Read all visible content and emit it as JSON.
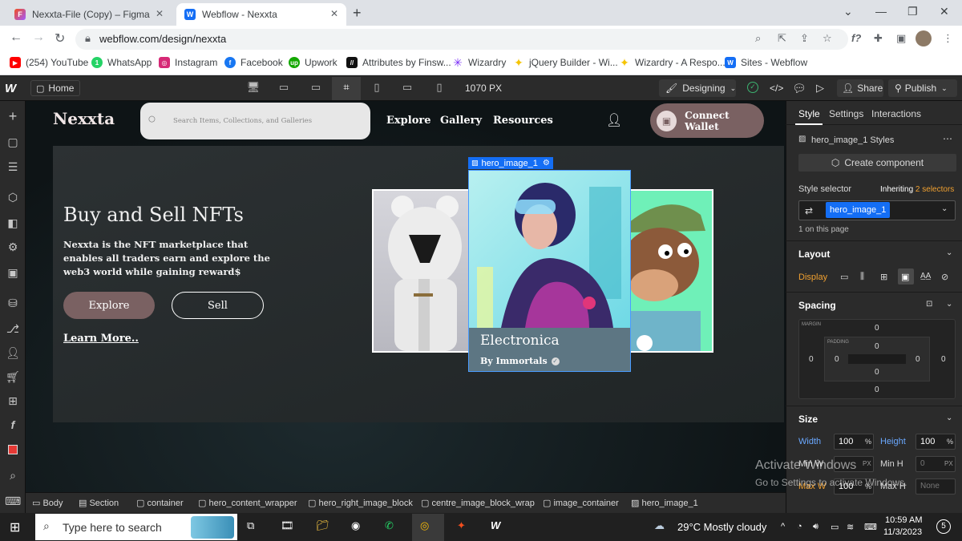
{
  "browser": {
    "tabs": [
      {
        "label": "Nexxta-File (Copy) – Figma"
      },
      {
        "label": "Webflow - Nexxta"
      }
    ],
    "url": "webflow.com/design/nexxta",
    "bookmarks": [
      {
        "label": "(254) YouTube",
        "color": "#ff0000"
      },
      {
        "label": "WhatsApp",
        "color": "#25d366"
      },
      {
        "label": "Instagram",
        "color": "#d62976"
      },
      {
        "label": "Facebook",
        "color": "#1877f2"
      },
      {
        "label": "Upwork",
        "color": "#14a800"
      },
      {
        "label": "Attributes by Finsw...",
        "color": "#111111"
      },
      {
        "label": "Wizardry",
        "color": "#7b2ff7"
      },
      {
        "label": "jQuery Builder - Wi...",
        "color": "#f5c400"
      },
      {
        "label": "Wizardry - A Respo...",
        "color": "#f5c400"
      },
      {
        "label": "Sites - Webflow",
        "color": "#146ef5"
      }
    ]
  },
  "webflow": {
    "home_label": "Home",
    "viewport_width": "1070 PX",
    "mode_label": "Designing",
    "share_label": "Share",
    "publish_label": "Publish"
  },
  "site": {
    "logo": "Nexxta",
    "search_placeholder": "Search Items, Collections, and Galleries",
    "nav": [
      "Explore",
      "Gallery",
      "Resources"
    ],
    "connect_label": "Connect Wallet",
    "hero_title": "Buy and Sell NFTs",
    "hero_text": "Nexxta is the NFT marketplace that enables all traders earn and  explore the web3 world while gaining reward$",
    "explore_btn": "Explore",
    "sell_btn": "Sell",
    "learn_more": "Learn More..",
    "selected_tag": "hero_image_1",
    "card_title": "Electronica",
    "card_by": "By Immortals"
  },
  "panel": {
    "tabs": [
      "Style",
      "Settings",
      "Interactions"
    ],
    "styles_title": "hero_image_1 Styles",
    "create_component": "Create component",
    "style_selector_label": "Style selector",
    "inheriting_label": "Inheriting",
    "inheriting_count": "2 selectors",
    "selector_chip": "hero_image_1",
    "on_page": "1 on this page",
    "layout_label": "Layout",
    "display_label": "Display",
    "spacing_label": "Spacing",
    "margin_label": "MARGIN",
    "padding_label": "PADDING",
    "zero": "0",
    "size_label": "Size",
    "width_label": "Width",
    "width_value": "100",
    "pct": "%",
    "height_label": "Height",
    "height_value": "100",
    "minw_label": "Min W",
    "px": "PX",
    "minh_label": "Min H",
    "minh_value": "0",
    "maxw_label": "Max W",
    "maxw_value": "100",
    "maxh_label": "Max H",
    "maxh_value": "None"
  },
  "watermark": {
    "line1": "Activate Windows",
    "line2": "Go to Settings to activate Windows."
  },
  "breadcrumbs": [
    "Body",
    "Section",
    "container",
    "hero_content_wrapper",
    "hero_right_image_block",
    "centre_image_block_wrap",
    "image_container",
    "hero_image_1"
  ],
  "taskbar": {
    "search_placeholder": "Type here to search",
    "weather": "29°C  Mostly cloudy",
    "time": "10:59 AM",
    "date": "11/3/2023",
    "notif": "5"
  }
}
